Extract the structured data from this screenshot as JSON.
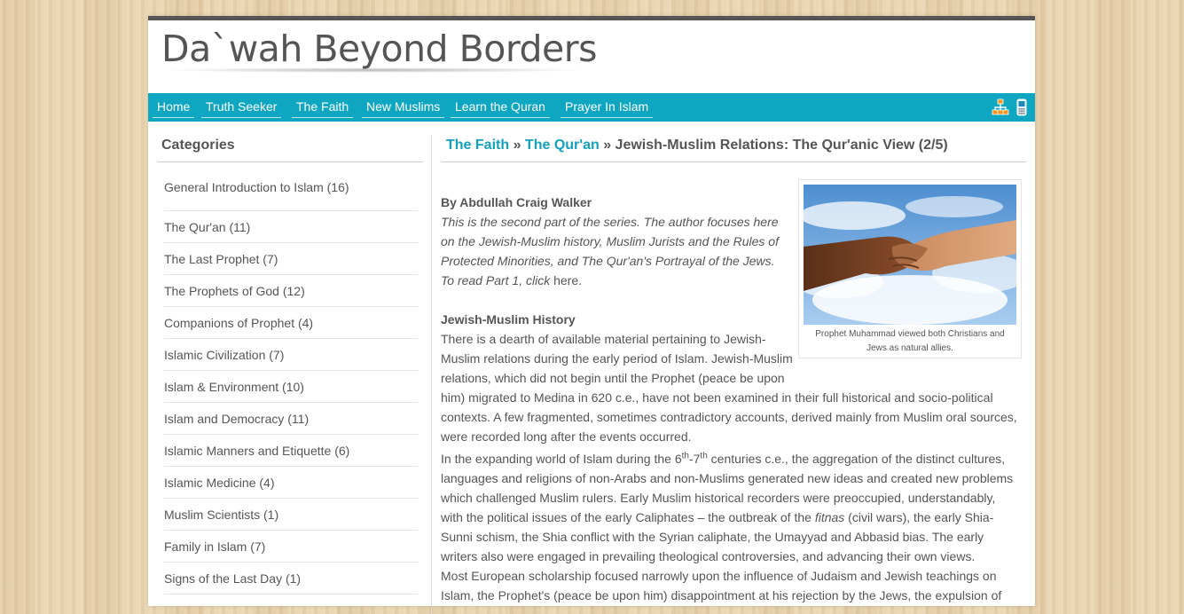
{
  "site": {
    "logo": "Da`wah Beyond Borders"
  },
  "nav": {
    "items": [
      "Home",
      "Truth Seeker",
      "The Faith",
      "New Muslims",
      "Learn the Quran",
      "Prayer In Islam"
    ],
    "icons": [
      "sitemap-icon",
      "mobile-icon"
    ],
    "accent": "#0fa6c2"
  },
  "sidebar": {
    "title": "Categories",
    "items": [
      "General Introduction to Islam (16)",
      "The Qur'an (11)",
      "The Last Prophet (7)",
      "The Prophets of God (12)",
      "Companions of Prophet (4)",
      "Islamic Civilization (7)",
      "Islam & Environment (10)",
      "Islam and Democracy (11)",
      "Islamic Manners and Etiquette (6)",
      "Islamic Medicine (4)",
      "Muslim Scientists (1)",
      "Family in Islam (7)",
      "Signs of the Last Day (1)"
    ]
  },
  "breadcrumb": {
    "first": "The Faith",
    "sep": "»",
    "second": "The Qur'an",
    "current": "Jewish-Muslim Relations: The Qur'anic View (2/5)"
  },
  "figure": {
    "caption1": "Prophet Muhammad viewed both Christians and",
    "caption2": "Jews as natural allies."
  },
  "article": {
    "author": "By Abdullah Craig Walker",
    "intro1": "This is the second part of the series. The author focuses here",
    "intro2": "on the Jewish-Muslim history, Muslim Jurists and the Rules of",
    "intro3": "Protected Minorities, and The Qur'an's Portrayal of the Jews.",
    "intro4a": "To read Part 1, click",
    "intro4b": " here.",
    "heading": "Jewish-Muslim History",
    "p1l1": "There is a dearth of available material pertaining to Jewish-",
    "p1l2": "Muslim relations during the early period of Islam. Jewish-Muslim",
    "p1l3": "relations, which did not begin until the Prophet (peace be upon",
    "p1l4": "him) migrated to Medina in 620 c.e., have not been examined in their full historical and socio-political",
    "p1l5": "contexts. A few fragmented, sometimes contradictory accounts, derived mainly from Muslim oral sources,",
    "p1l6": "were recorded long after the events occurred.",
    "p2a": "In the expanding world of Islam during the 6",
    "p2sup1": "th",
    "p2b": "-7",
    "p2sup2": "th",
    "p2c": " centuries c.e., the aggregation of the distinct cultures,",
    "p2l2": "languages and religions of non-Arabs and non-Muslims generated new ideas and created new problems",
    "p2l3": "which challenged Muslim rulers.  Early Muslim historical recorders were preoccupied, understandably,",
    "p2l4a": "with the political issues of the early Caliphates – the outbreak of the ",
    "p2l4b": "fitnas",
    "p2l4c": " (civil wars), the early Shia-",
    "p2l5": "Sunni schism, the Shia conflict with the Syrian caliphate, the Umayyad and Abbasid bias. The early",
    "p2l6": "writers also were engaged in prevailing theological controversies, and advancing their own views.",
    "p3l1": "Most European scholarship focused narrowly upon the influence of Judaism and Jewish teachings on",
    "p3l2": "Islam, the Prophet's (peace be upon him) disappointment at his rejection by the Jews, the expulsion of"
  }
}
